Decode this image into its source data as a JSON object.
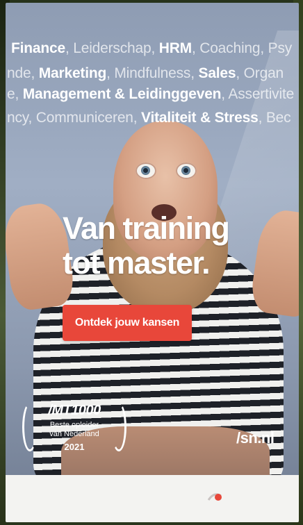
{
  "keywords": {
    "line1": [
      {
        "text": "Finance",
        "bold": true
      },
      {
        "text": ", Leiderschap, ",
        "bold": false
      },
      {
        "text": "HRM",
        "bold": true
      },
      {
        "text": ", Coaching, Psy",
        "bold": false
      }
    ],
    "line2": [
      {
        "text": "nde, ",
        "bold": false
      },
      {
        "text": "Marketing",
        "bold": true
      },
      {
        "text": ", Mindfulness, ",
        "bold": false
      },
      {
        "text": "Sales",
        "bold": true
      },
      {
        "text": ", Organ",
        "bold": false
      }
    ],
    "line3": [
      {
        "text": "e, ",
        "bold": false
      },
      {
        "text": "Management & Leidinggeven",
        "bold": true
      },
      {
        "text": ", Assertivite",
        "bold": false
      }
    ],
    "line4": [
      {
        "text": "ncy, Communiceren, ",
        "bold": false
      },
      {
        "text": "Vitaliteit & Stress",
        "bold": true
      },
      {
        "text": ", Bec",
        "bold": false
      }
    ]
  },
  "headline": {
    "line1": "Van training",
    "line2": "tot master."
  },
  "cta_label": "Ontdek jouw kansen",
  "award": {
    "title": "/MT1000",
    "line1": "Beste opleider",
    "line2": "van Nederland",
    "year": "2021"
  },
  "site": "/sn.nl",
  "colors": {
    "cta": "#e8473a",
    "text": "#ffffff",
    "banner": "#a0aec4"
  }
}
